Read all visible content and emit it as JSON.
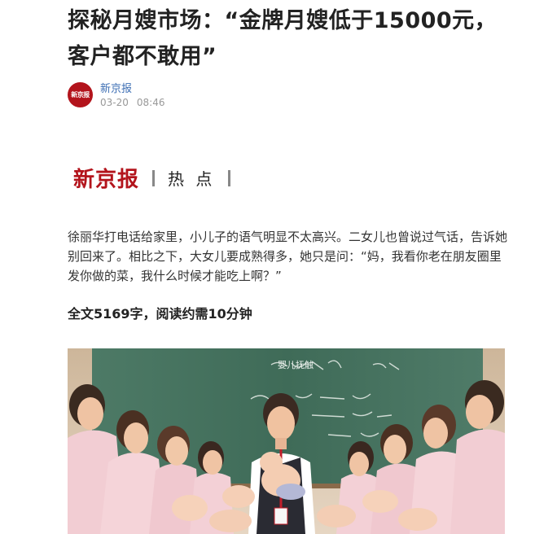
{
  "article": {
    "title_line1": "探秘月嫂市场：“金牌月嫂低于15000元，",
    "title_line2": "客户都不敢用”",
    "source": "新京报",
    "avatar_text": "新京报",
    "date": "03-20",
    "time": "08:46"
  },
  "banner": {
    "brand": "新京报",
    "tag": "热 点"
  },
  "summary": "徐丽华打电话给家里，小儿子的语气明显不太高兴。二女儿也曾说过气话，告诉她别回来了。相比之下，大女儿要成熟得多，她只是问：“妈，我看你老在朋友圈里发你做的菜，我什么时候才能吃上啊？”",
  "reading_info": "全文5169字，阅读约需10分钟",
  "photo": {
    "blackboard_text": [
      "婴儿抚触",
      "作用",
      "促进生长发育",
      "增强免疫力",
      "宝宝"
    ],
    "colors": {
      "board": "#3f6b58",
      "uniform": "#f0c9cf",
      "skin": "#f2c7a8",
      "wall": "#d9c3a8"
    }
  }
}
